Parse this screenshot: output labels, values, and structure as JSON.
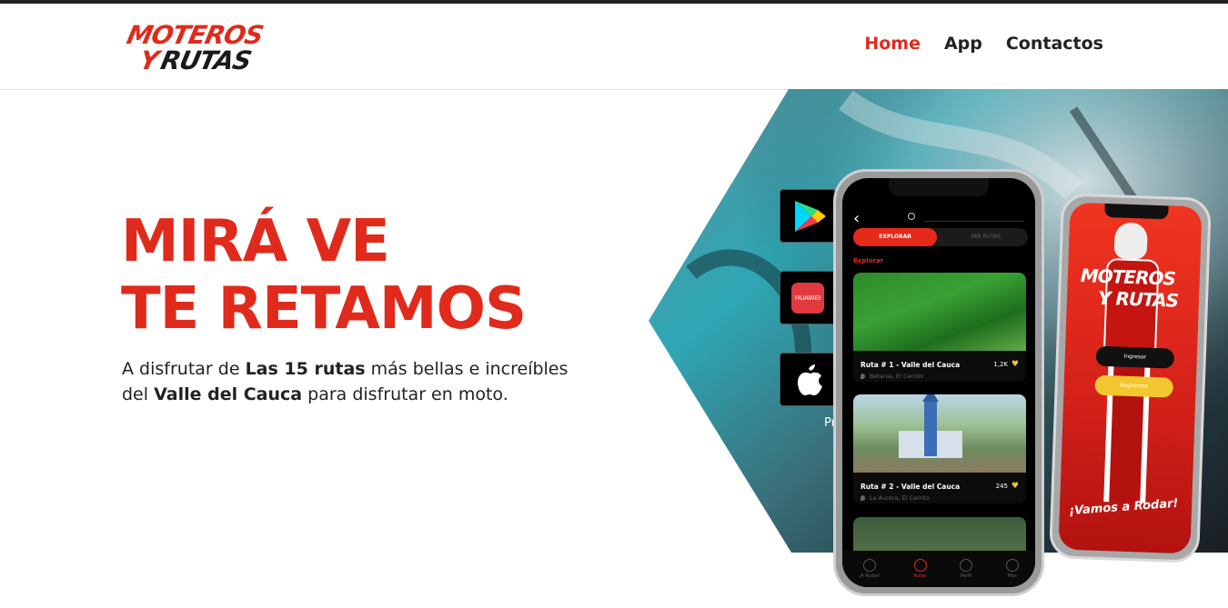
{
  "header": {
    "logo_line1": "MOTEROS",
    "logo_line2_y": "Y",
    "logo_line2": "RUTAS",
    "nav": [
      {
        "label": "Home",
        "active": true
      },
      {
        "label": "App",
        "active": false
      },
      {
        "label": "Contactos",
        "active": false
      }
    ]
  },
  "hero": {
    "title_line1": "MIRÁ VE",
    "title_line2": "TE RETAMOS",
    "sub_part1": "A disfrutar de ",
    "sub_bold1": "Las 15 rutas",
    "sub_part2": " más bellas e increíbles del ",
    "sub_bold2": "Valle del Cauca",
    "sub_part3": " para disfrutar en moto."
  },
  "stores": {
    "huawei_label": "HUAWEI",
    "caption": "Pr"
  },
  "phone_list": {
    "tab_explore": "EXPLORAR",
    "tab_mine": "MIS RUTAS",
    "section": "Explorar",
    "cards": [
      {
        "title": "Ruta # 1 - Valle del Cauca",
        "place": "Betania, El Cerrito",
        "likes": "1,2K"
      },
      {
        "title": "Ruta # 2 - Valle del Cauca",
        "place": "La Aurora, El Cerrito",
        "likes": "245"
      }
    ],
    "bottom_nav": [
      "¡A Rodar!",
      "Rutas",
      "Perfil",
      "Más"
    ]
  },
  "phone_login": {
    "logo_line1": "MOTEROS",
    "logo_line2": "Y RUTAS",
    "login_label": "Ingresar",
    "register_label": "Registrate",
    "slogan": "¡Vamos a Rodar!"
  },
  "colors": {
    "brand_red": "#e02a1c",
    "dark": "#222222",
    "accent_yellow": "#f2c62f"
  }
}
